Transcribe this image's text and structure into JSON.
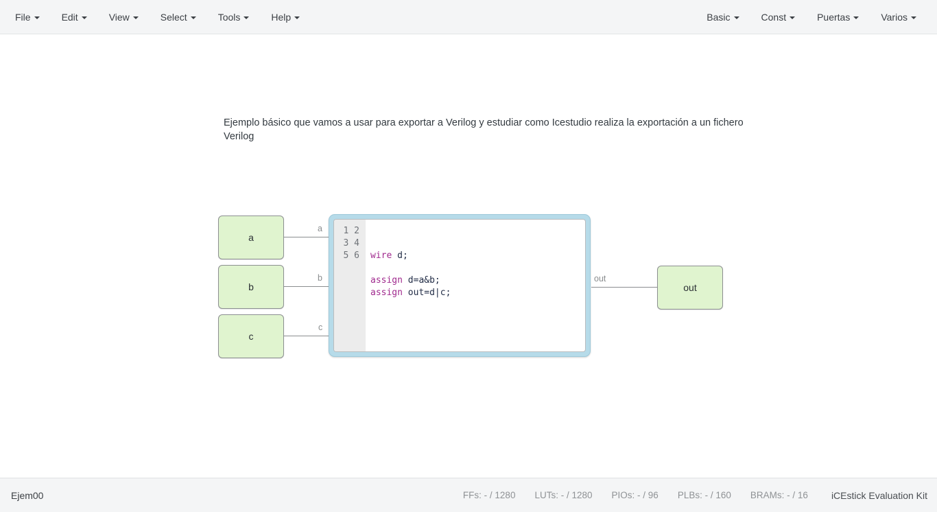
{
  "menu": {
    "left_items": [
      {
        "label": "File",
        "name": "menu-file"
      },
      {
        "label": "Edit",
        "name": "menu-edit"
      },
      {
        "label": "View",
        "name": "menu-view"
      },
      {
        "label": "Select",
        "name": "menu-select"
      },
      {
        "label": "Tools",
        "name": "menu-tools"
      },
      {
        "label": "Help",
        "name": "menu-help"
      }
    ],
    "right_items": [
      {
        "label": "Basic",
        "name": "menu-basic"
      },
      {
        "label": "Const",
        "name": "menu-const"
      },
      {
        "label": "Puertas",
        "name": "menu-puertas"
      },
      {
        "label": "Varios",
        "name": "menu-varios"
      }
    ]
  },
  "canvas": {
    "description": "Ejemplo básico que vamos a usar para exportar a Verilog y estudiar como Icestudio realiza la exportación a un fichero Verilog",
    "blocks": {
      "input_a": "a",
      "input_b": "b",
      "input_c": "c",
      "output_out": "out"
    },
    "port_labels": {
      "a": "a",
      "b": "b",
      "c": "c",
      "out": "out"
    },
    "code_block": {
      "line_numbers": "1\n2\n3\n4\n5\n6",
      "code_line_1": "",
      "code_line_2": "",
      "code_line_3_kw": "wire",
      "code_line_3_rest": " d;",
      "code_line_4": "",
      "code_line_5_kw": "assign",
      "code_line_5_rest": " d=a&b;",
      "code_line_6_kw": "assign",
      "code_line_6_rest": " out=d|c;",
      "full_code": "\n\nwire d;\n\nassign d=a&b;\nassign out=d|c;"
    },
    "colors": {
      "block_fill": "#e0f4cf",
      "block_border": "#8c8f91",
      "code_frame": "#b6dbe9",
      "keyword": "#a02a8e",
      "code_text": "#1f2a44",
      "wire": "#8a8d8f"
    }
  },
  "statusbar": {
    "project_name": "Ejem00",
    "resources": [
      {
        "label": "FFs:",
        "value": "- / 1280",
        "name": "resource-ffs"
      },
      {
        "label": "LUTs:",
        "value": "- / 1280",
        "name": "resource-luts"
      },
      {
        "label": "PIOs:",
        "value": "- / 96",
        "name": "resource-pios"
      },
      {
        "label": "PLBs:",
        "value": "- / 160",
        "name": "resource-plbs"
      },
      {
        "label": "BRAMs:",
        "value": "- / 16",
        "name": "resource-brams"
      }
    ],
    "board": "iCEstick Evaluation Kit"
  }
}
